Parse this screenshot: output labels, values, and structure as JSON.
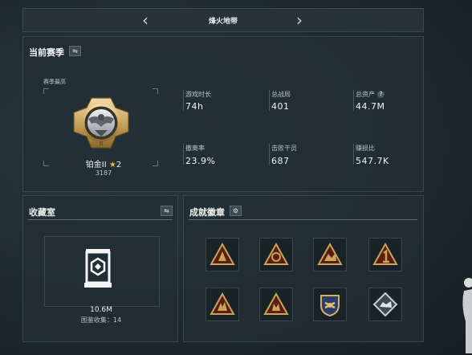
{
  "header": {
    "title": "烽火地带",
    "prev_icon": "chevron-left",
    "next_icon": "chevron-right"
  },
  "season": {
    "title": "当前赛季",
    "best_label": "赛季最高",
    "rank_name": "铂金II",
    "rank_level": "2",
    "rank_score": "3187",
    "stats": [
      {
        "label": "游戏时长",
        "value": "74h"
      },
      {
        "label": "总战局",
        "value": "401"
      },
      {
        "label": "总资产",
        "value": "44.7M"
      },
      {
        "label": "撤离率",
        "value": "23.9%"
      },
      {
        "label": "击败干员",
        "value": "687"
      },
      {
        "label": "赚损比",
        "value": "547.7K"
      }
    ]
  },
  "collection": {
    "title": "收藏室",
    "value": "10.6M",
    "count_label": "图鉴收集：",
    "count": "14"
  },
  "achievements": {
    "title": "成就徽章",
    "settings_icon": "gear-icon"
  },
  "colors": {
    "accent": "#c9a45a",
    "badge_bg": "#5a1f12",
    "panel_bg": "#222e34"
  }
}
